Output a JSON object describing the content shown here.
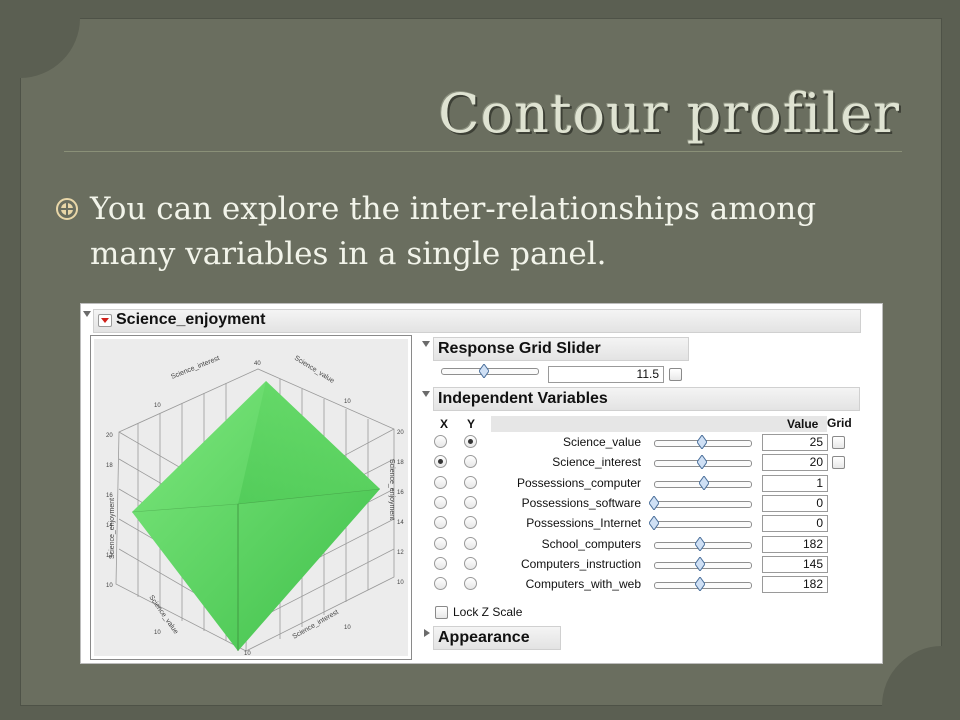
{
  "slide": {
    "title": "Contour profiler",
    "bullet": "You can explore the inter-relationships among many variables in a single panel."
  },
  "panel": {
    "outline_title": "Science_enjoyment",
    "plot": {
      "surface_color": "#5fd65f",
      "axis_top_left": "Science_interest",
      "axis_top_right": "Science_value",
      "axis_left": "Science_enjoyment",
      "axis_right": "Science_enjoyment",
      "axis_bottom_left": "Science_value",
      "axis_bottom_right": "Science_interest"
    },
    "response_grid": {
      "title": "Response Grid Slider",
      "value": "11.5",
      "slider_fraction": 0.45
    },
    "independent": {
      "title": "Independent Variables",
      "col_x": "X",
      "col_y": "Y",
      "col_value": "Value",
      "col_grid": "Grid",
      "rows": [
        {
          "name": "Science_value",
          "x": false,
          "y": true,
          "value": "25",
          "slider_fraction": 0.5,
          "grid": true
        },
        {
          "name": "Science_interest",
          "x": true,
          "y": false,
          "value": "20",
          "slider_fraction": 0.5,
          "grid": true
        },
        {
          "name": "Possessions_computer",
          "x": false,
          "y": false,
          "value": "1",
          "slider_fraction": 0.52,
          "grid": false
        },
        {
          "name": "Possessions_software",
          "x": false,
          "y": false,
          "value": "0",
          "slider_fraction": 0.0,
          "grid": false
        },
        {
          "name": "Possessions_Internet",
          "x": false,
          "y": false,
          "value": "0",
          "slider_fraction": 0.0,
          "grid": false
        },
        {
          "name": "School_computers",
          "x": false,
          "y": false,
          "value": "182",
          "slider_fraction": 0.48,
          "grid": false
        },
        {
          "name": "Computers_instruction",
          "x": false,
          "y": false,
          "value": "145",
          "slider_fraction": 0.48,
          "grid": false
        },
        {
          "name": "Computers_with_web",
          "x": false,
          "y": false,
          "value": "182",
          "slider_fraction": 0.48,
          "grid": false
        }
      ]
    },
    "lock_z_scale": "Lock Z Scale",
    "appearance": "Appearance"
  }
}
